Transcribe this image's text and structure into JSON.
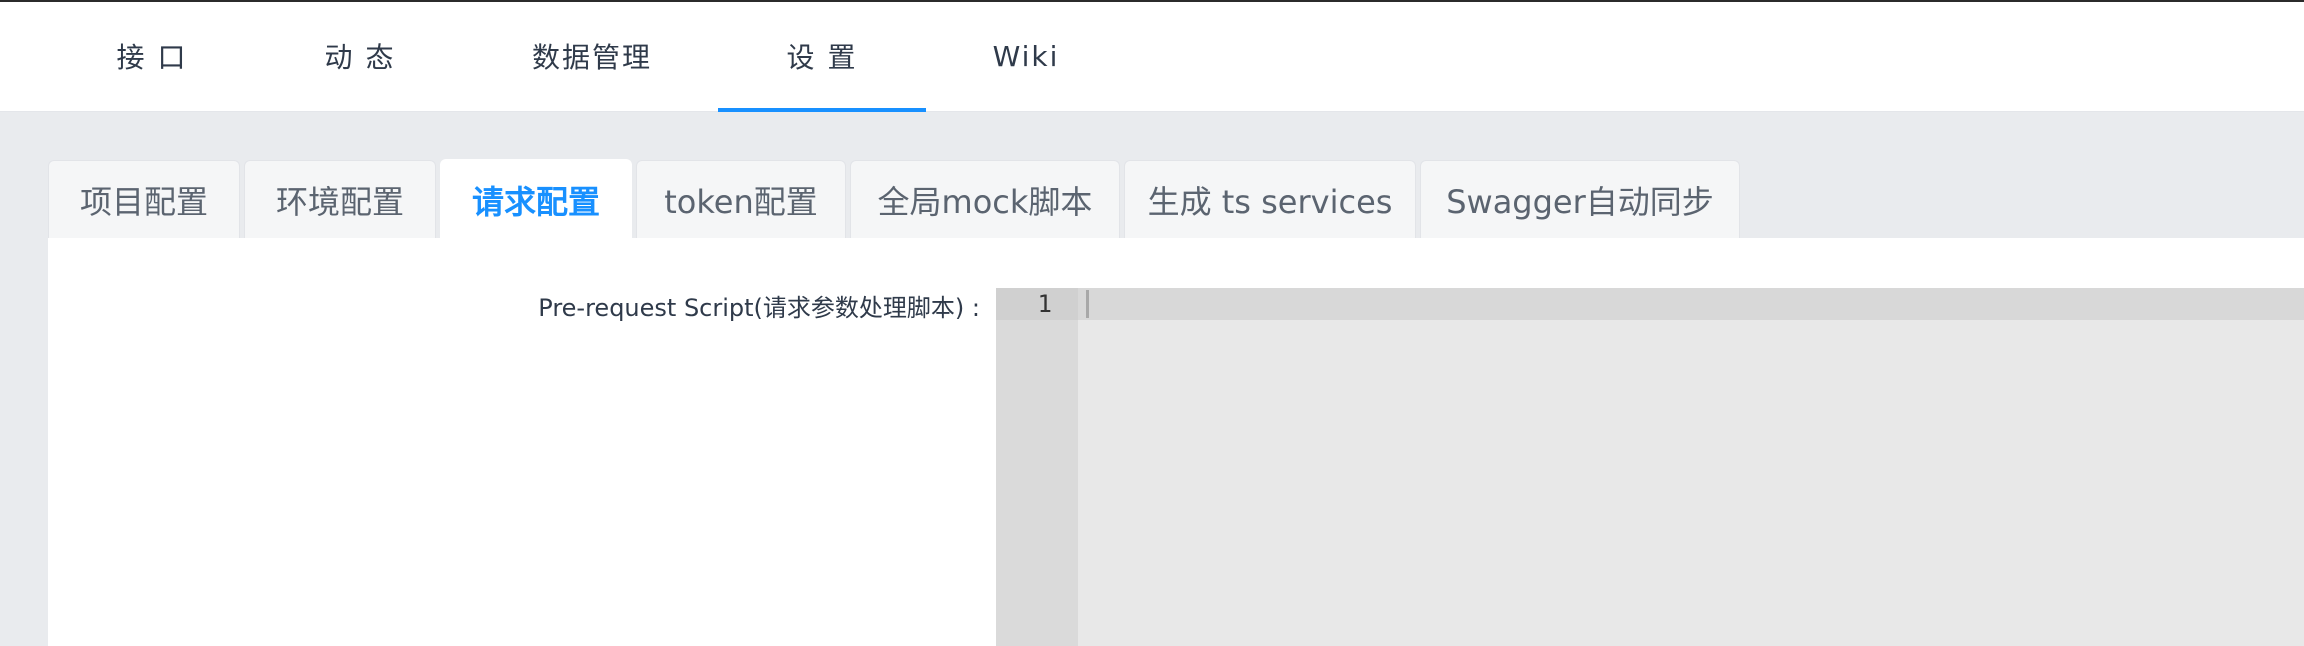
{
  "top_nav": {
    "items": [
      {
        "label": "接 口"
      },
      {
        "label": "动 态"
      },
      {
        "label": "数据管理"
      },
      {
        "label": "设 置"
      },
      {
        "label": "Wiki"
      }
    ],
    "active_index": 3,
    "accent_color": "#1890ff"
  },
  "settings_tabs": {
    "items": [
      {
        "label": "项目配置"
      },
      {
        "label": "环境配置"
      },
      {
        "label": "请求配置"
      },
      {
        "label": "token配置"
      },
      {
        "label": "全局mock脚本"
      },
      {
        "label": "生成 ts services"
      },
      {
        "label": "Swagger自动同步"
      }
    ],
    "active_index": 2
  },
  "form": {
    "pre_request_label": "Pre-request Script(请求参数处理脚本) :"
  },
  "editor": {
    "line_numbers": [
      "1"
    ],
    "content": ""
  }
}
